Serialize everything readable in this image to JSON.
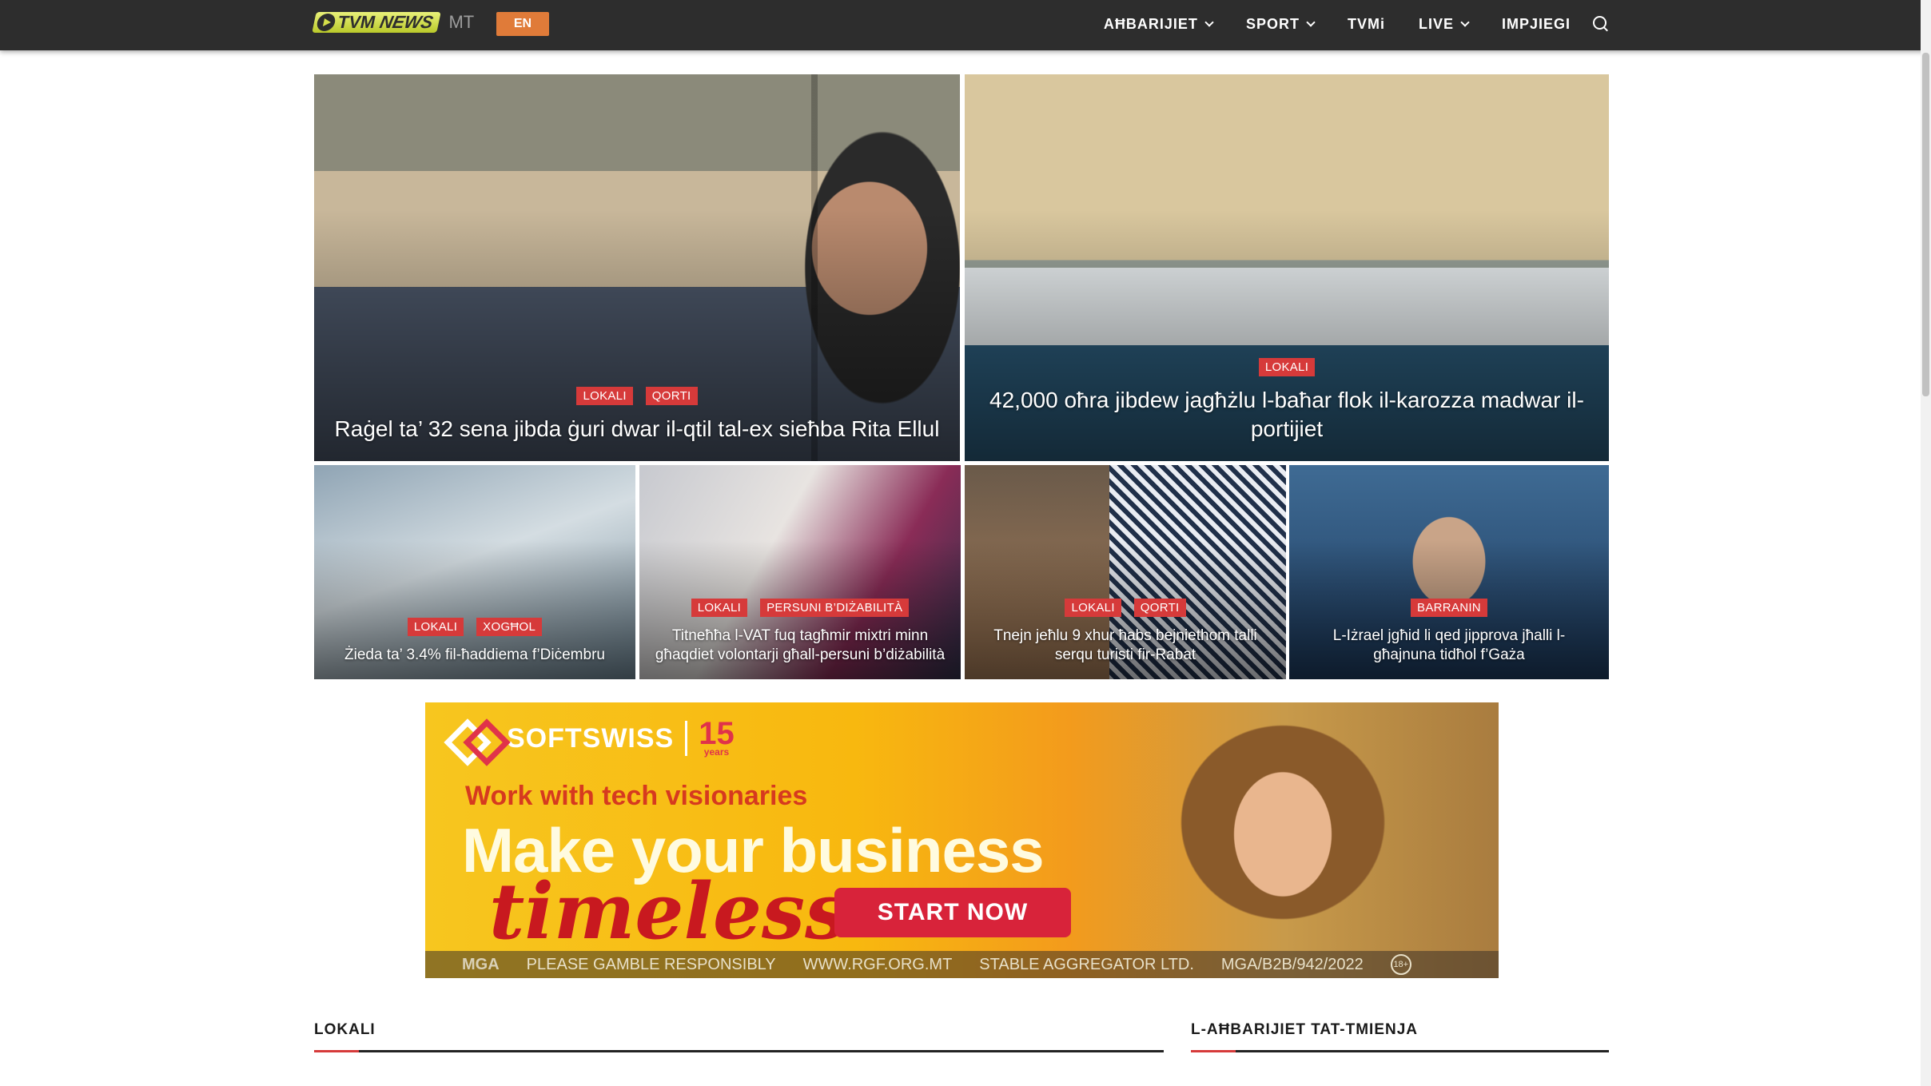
{
  "header": {
    "logo_text_tvm": "TVM",
    "logo_text_news": "NEWS",
    "logo_suffix": "MT",
    "lang_button": "EN",
    "nav": [
      {
        "label": "AĦBARIJIET",
        "dropdown": true
      },
      {
        "label": "SPORT",
        "dropdown": true
      },
      {
        "label": "TVMi",
        "dropdown": false
      },
      {
        "label": "LIVE",
        "dropdown": true
      },
      {
        "label": "IMPJIEGI",
        "dropdown": false
      }
    ],
    "search_icon": "search-icon"
  },
  "featured": [
    {
      "tags": [
        "LOKALI",
        "QORTI"
      ],
      "title": "Raġel ta’ 32 sena jibda ġuri dwar il-qtil tal-ex sieħba Rita Ellul"
    },
    {
      "tags": [
        "LOKALI"
      ],
      "title": "42,000 oħra jibdew jagħżlu l-baħar flok il-karozza madwar il-portijiet"
    },
    {
      "tags": [
        "LOKALI",
        "XOGĦOL"
      ],
      "title": "Żieda ta’ 3.4% fil-ħaddiema f’Diċembru"
    },
    {
      "tags": [
        "LOKALI",
        "PERSUNI B’DIŻABILITÀ"
      ],
      "title": "Titneħħa l-VAT fuq tagħmir mixtri minn għaqdiet volontarji għall-persuni b’diżabilità"
    },
    {
      "tags": [
        "LOKALI",
        "QORTI"
      ],
      "title": "Tnejn jeħlu 9 xhur ħabs bejniethom talli serqu turisti fir-Rabat"
    },
    {
      "tags": [
        "BARRANIN"
      ],
      "title": "L-Iżrael jgħid li qed jipprova jħalli l-għajnuna tidħol f’Gaża"
    }
  ],
  "ad": {
    "brand": "SOFTSWISS",
    "years_number": "15",
    "years_word": "years",
    "tagline": "Work with tech visionaries",
    "headline": "Make your business",
    "script": "timeless",
    "cta": "START NOW",
    "footer": [
      "MGA",
      "PLEASE GAMBLE RESPONSIBLY",
      "WWW.RGF.ORG.MT",
      "STABLE AGGREGATOR LTD.",
      "MGA/B2B/942/2022"
    ],
    "age_badge": "18+"
  },
  "sections": {
    "left_title": "LOKALI",
    "right_title": "L-AĦBARIJIET TAT-TMIENJA"
  },
  "colors": {
    "topbar": "#2d2d2d",
    "accent": "#d63a3a",
    "lang_button": "#e07b39"
  }
}
